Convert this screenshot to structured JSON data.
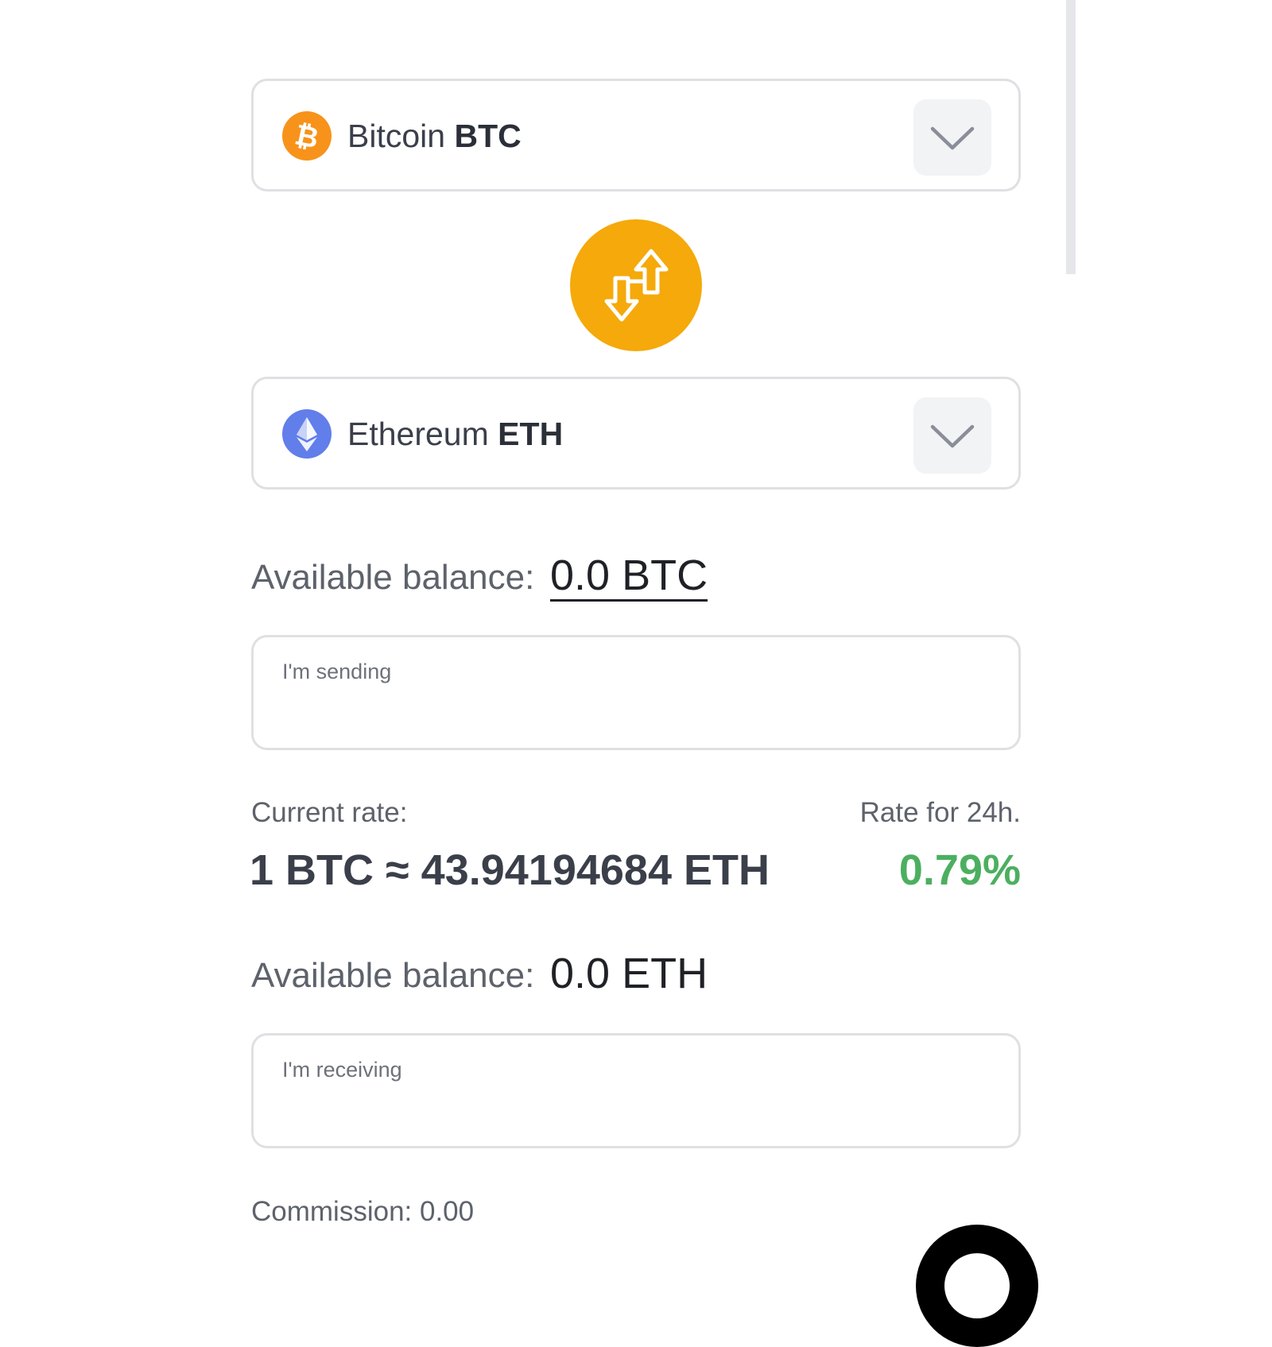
{
  "from_currency": {
    "name": "Bitcoin",
    "ticker": "BTC",
    "icon": "bitcoin-icon",
    "color": "#f7931a"
  },
  "to_currency": {
    "name": "Ethereum",
    "ticker": "ETH",
    "icon": "ethereum-icon",
    "color": "#627eea"
  },
  "swap_button": {
    "icon": "swap-arrows-icon",
    "color": "#f5a90a"
  },
  "send_section": {
    "balance_label": "Available balance:",
    "balance_value": "0.0 BTC",
    "input_placeholder": "I'm sending"
  },
  "rate": {
    "label": "Current rate:",
    "value": "1 BTC ≈ 43.94194684 ETH",
    "change_label": "Rate for 24h.",
    "change_value": "0.79%",
    "change_color": "#4caf60"
  },
  "receive_section": {
    "balance_label": "Available balance:",
    "balance_value": "0.0 ETH",
    "input_placeholder": "I'm receiving"
  },
  "commission": "Commission: 0.00"
}
